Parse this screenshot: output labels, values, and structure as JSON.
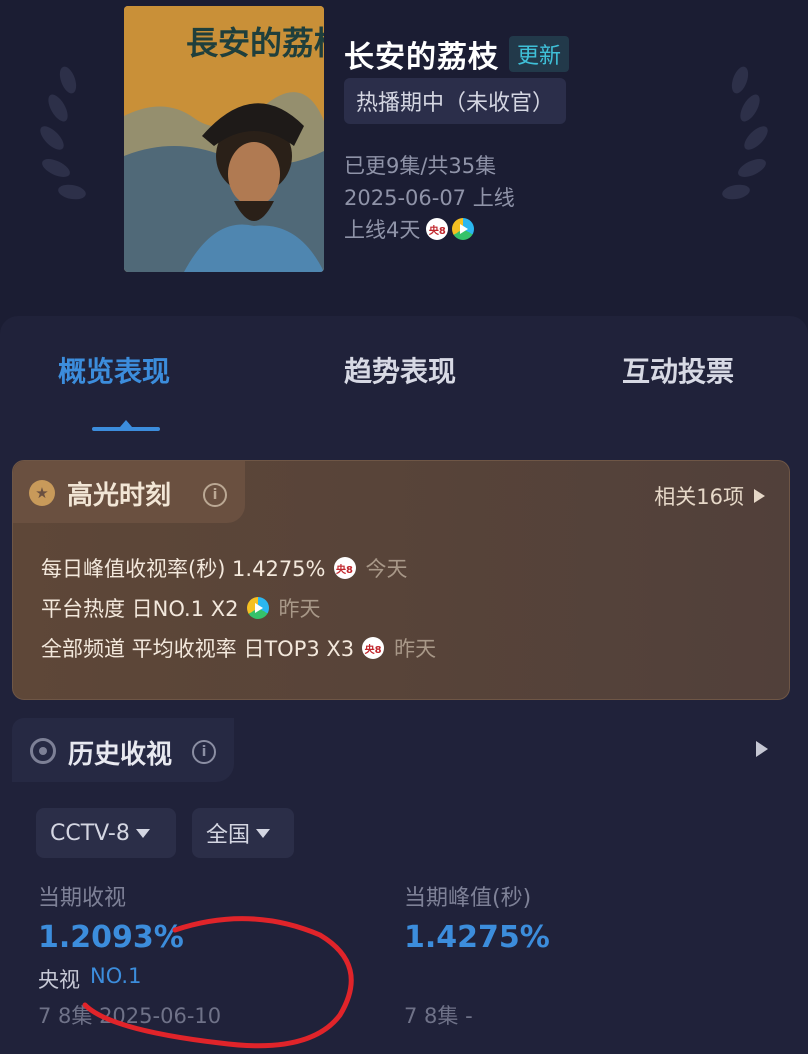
{
  "header": {
    "title": "长安的荔枝",
    "update_badge": "更新",
    "status": "热播期中（未收官）",
    "episodes": "已更9集/共35集",
    "release": "2025-06-07 上线",
    "days_online": "上线4天",
    "poster_title": "長安的荔枝"
  },
  "tabs": [
    "概览表现",
    "趋势表现",
    "互动投票"
  ],
  "highlight": {
    "title": "高光时刻",
    "related": "相关16项",
    "lines": [
      {
        "text": "每日峰值收视率(秒) 1.4275%",
        "day": "今天",
        "platform": "cctv8"
      },
      {
        "text": "平台热度 日NO.1 X2",
        "day": "昨天",
        "platform": "tencent"
      },
      {
        "text": "全部频道 平均收视率 日TOP3 X3",
        "day": "昨天",
        "platform": "cctv8"
      }
    ]
  },
  "history": {
    "title": "历史收视",
    "channel": "CCTV-8",
    "region": "全国",
    "current_label": "当期收视",
    "current_value": "1.2093%",
    "rank_label": "央视",
    "rank_value": "NO.1",
    "current_foot": "7 8集 2025-06-10",
    "peak_label": "当期峰值(秒)",
    "peak_value": "1.4275%",
    "peak_foot": "7 8集 -"
  },
  "colors": {
    "accent": "#3c8ddc",
    "background": "#1b1d33",
    "highlight_bg": "#5e4738",
    "annotation": "#e0242a"
  },
  "icons": {
    "cctv8": "央8",
    "tencent": "tencent-video-icon"
  }
}
